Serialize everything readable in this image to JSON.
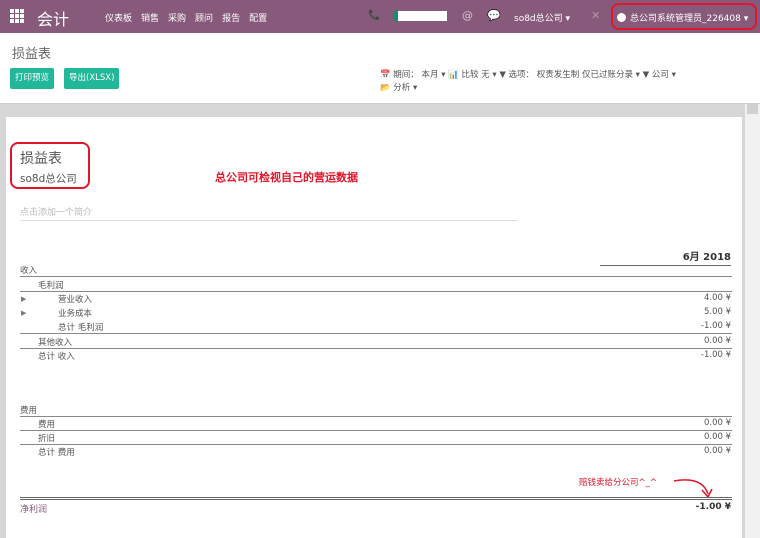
{
  "navbar": {
    "app_name": "会计",
    "menu": [
      "仪表板",
      "销售",
      "采购",
      "顾问",
      "报告",
      "配置"
    ],
    "company": "so8d总公司 ▾",
    "user": "总公司系统管理员_226408 ▾"
  },
  "control": {
    "breadcrumb": "损益表",
    "print_label": "打印预览",
    "export_label": "导出(XLSX)",
    "filter_line1": "📅 期间： 本月 ▾   📊 比较 无 ▾   ▼ 选项： 权责发生制 仅已过账分录 ▾   ▼ 公司 ▾",
    "filter_line2": "📂 分析 ▾"
  },
  "report": {
    "title": "损益表",
    "company": "so8d总公司",
    "annotation": "总公司可检视自己的营运数据",
    "summary_placeholder": "点击添加一个简介",
    "column_header": "6月 2018",
    "income": "收入",
    "gross_profit": "毛利润",
    "operating_income": "营业收入",
    "operating_income_amt": "4.00 ¥",
    "cost_of_revenue": "业务成本",
    "cost_of_revenue_amt": "5.00 ¥",
    "total_gross_profit": "总计 毛利润",
    "total_gross_profit_amt": "-1.00 ¥",
    "other_income": "其他收入",
    "other_income_amt": "0.00 ¥",
    "total_income": "总计 收入",
    "total_income_amt": "-1.00 ¥",
    "expenses": "费用",
    "expense": "费用",
    "expense_amt": "0.00 ¥",
    "depreciation": "折旧",
    "depreciation_amt": "0.00 ¥",
    "total_expenses": "总计 费用",
    "total_expenses_amt": "0.00 ¥",
    "annotation2": "赔钱卖给分公司^_^",
    "net_profit": "净利润",
    "net_profit_amt": "-1.00 ¥"
  },
  "colors": {
    "navbar": "#875a7b",
    "primary_button": "#21b799",
    "annotation": "#e0162b"
  }
}
